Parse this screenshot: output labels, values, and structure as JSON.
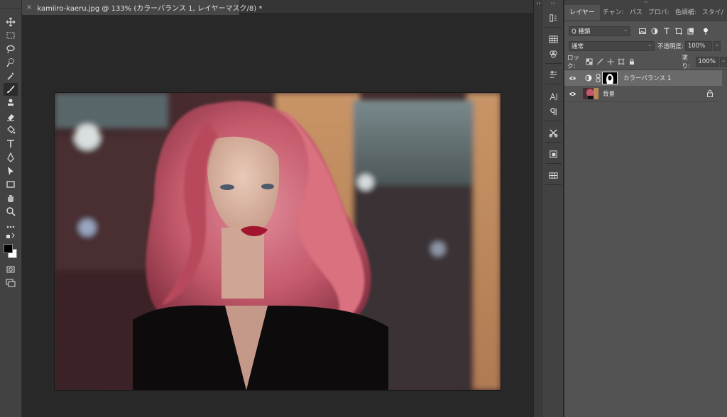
{
  "document_tab": {
    "title": "kamiiro-kaeru.jpg @ 133% (カラーバランス 1, レイヤーマスク/8) *",
    "close_glyph": "×"
  },
  "toolbar": {
    "tools": [
      "move-icon",
      "marquee-icon",
      "lasso-icon",
      "quick-select-icon",
      "eyedropper-icon",
      "brush-icon",
      "stamp-icon",
      "eraser-icon",
      "paint-bucket-icon",
      "type-icon",
      "pen-icon",
      "path-select-icon",
      "rectangle-icon",
      "hand-icon",
      "zoom-icon",
      "more-icon"
    ],
    "active_tool": "brush-icon",
    "foreground_color": "#000000",
    "background_color": "#ffffff"
  },
  "panel_tabs": [
    "レイヤー",
    "チャンネル",
    "パス",
    "プロパティ",
    "色調補正",
    "スタイル"
  ],
  "panel_tabs_visible": [
    "レイヤー",
    "チャン:",
    "パス",
    "プロパ:",
    "色調補:",
    "スタイ/"
  ],
  "layers_panel": {
    "filter_kind": "Q 種類",
    "blend_mode": "通常",
    "opacity_label": "不透明度:",
    "opacity_value": "100%",
    "lock_label": "ロック:",
    "fill_label": "塗り:",
    "fill_value": "100%",
    "layers": [
      {
        "name": "カラーバランス 1",
        "visible": true,
        "selected": true,
        "type": "adjustment"
      },
      {
        "name": "背景",
        "visible": true,
        "selected": false,
        "type": "image",
        "locked": true
      }
    ]
  },
  "colors": {
    "app_bg": "#282828",
    "panel_bg": "#535353",
    "toolbar_bg": "#424242",
    "selected_layer": "#6a6a6a"
  }
}
